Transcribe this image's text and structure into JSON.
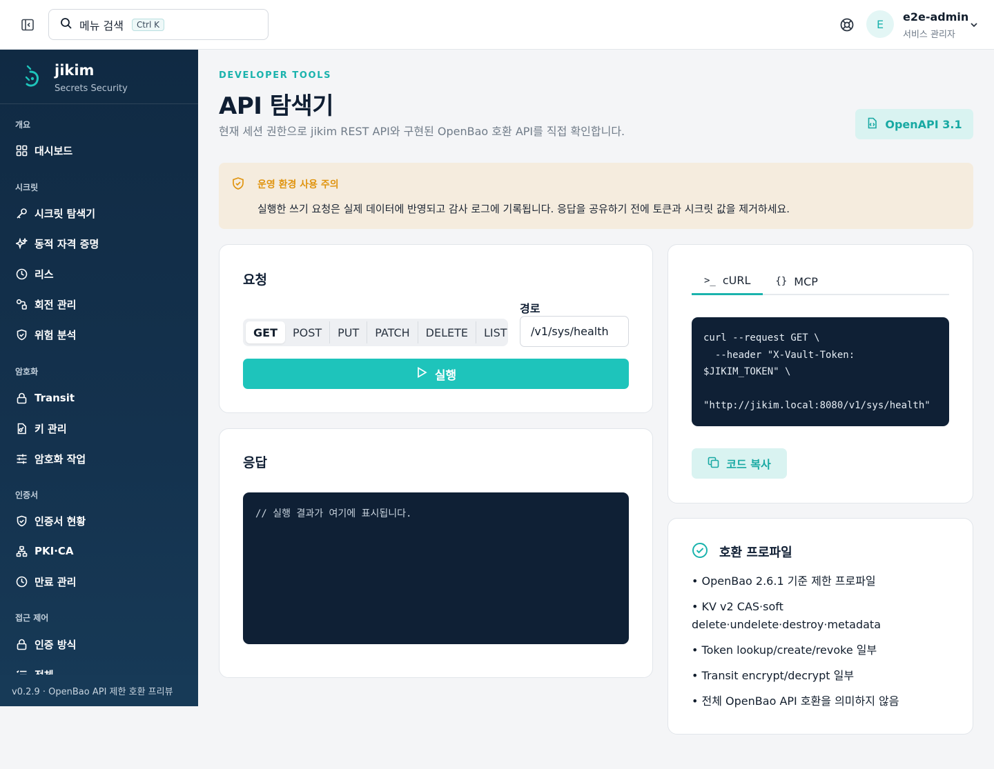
{
  "topbar": {
    "search_label": "메뉴 검색",
    "search_shortcut": "Ctrl K",
    "user": {
      "initial": "E",
      "name": "e2e-admin",
      "role": "서비스 관리자"
    }
  },
  "sidebar": {
    "brand": {
      "name": "jikim",
      "subtitle": "Secrets Security"
    },
    "sections": [
      {
        "title": "개요",
        "items": [
          {
            "label": "대시보드",
            "icon": "dashboard-icon"
          }
        ]
      },
      {
        "title": "시크릿",
        "items": [
          {
            "label": "시크릿 탐색기",
            "icon": "key-icon"
          },
          {
            "label": "동적 자격 증명",
            "icon": "sparkle-icon"
          },
          {
            "label": "리스",
            "icon": "clock-icon"
          },
          {
            "label": "회전 관리",
            "icon": "rotate-icon"
          },
          {
            "label": "위험 분석",
            "icon": "shield-icon"
          }
        ]
      },
      {
        "title": "암호화",
        "items": [
          {
            "label": "Transit",
            "icon": "lock-icon"
          },
          {
            "label": "키 관리",
            "icon": "key-file-icon"
          },
          {
            "label": "암호화 작업",
            "icon": "sliders-icon"
          }
        ]
      },
      {
        "title": "인증서",
        "items": [
          {
            "label": "인증서 현황",
            "icon": "shield-icon"
          },
          {
            "label": "PKI·CA",
            "icon": "network-icon"
          },
          {
            "label": "만료 관리",
            "icon": "clock-icon"
          }
        ]
      },
      {
        "title": "접근 제어",
        "items": [
          {
            "label": "인증 방식",
            "icon": "lock-icon"
          },
          {
            "label": "전체",
            "icon": "list-icon"
          }
        ]
      }
    ],
    "footer": "v0.2.9 · OpenBao API 제한 호환 프리뷰"
  },
  "header": {
    "eyebrow": "DEVELOPER TOOLS",
    "title": "API 탐색기",
    "description": "현재 세션 권한으로 jikim REST API와 구현된 OpenBao 호환 API를 직접 확인합니다.",
    "openapi_label": "OpenAPI 3.1"
  },
  "warning": {
    "title": "운영 환경 사용 주의",
    "body": "실행한 쓰기 요청은 실제 데이터에 반영되고 감사 로그에 기록됩니다. 응답을 공유하기 전에 토큰과 시크릿 값을 제거하세요."
  },
  "request": {
    "title": "요청",
    "methods": [
      "GET",
      "POST",
      "PUT",
      "PATCH",
      "DELETE",
      "LIST"
    ],
    "selected_method": "GET",
    "path_label": "경로",
    "path_value": "/v1/sys/health",
    "run_label": "실행"
  },
  "response": {
    "title": "응답",
    "placeholder": "// 실행 결과가 여기에 표시됩니다."
  },
  "code_panel": {
    "tabs": [
      "cURL",
      "MCP"
    ],
    "active_tab": "cURL",
    "code": "curl --request GET \\\n  --header \"X-Vault-Token:\n$JIKIM_TOKEN\" \\\n\n\"http://jikim.local:8080/v1/sys/health\"",
    "copy_label": "코드 복사"
  },
  "profile": {
    "title": "호환 프로파일",
    "items": [
      "• OpenBao 2.6.1 기준 제한 프로파일",
      "• KV v2 CAS·soft delete·undelete·destroy·metadata",
      "• Token lookup/create/revoke 일부",
      "• Transit encrypt/decrypt 일부",
      "• 전체 OpenBao API 호환을 의미하지 않음"
    ]
  },
  "colors": {
    "accent": "#1ec4bb",
    "accent_text": "#18a9a3",
    "sidebar_bg": "#102a43",
    "warning_bg": "#f5ecde",
    "warning_text": "#e0940f",
    "code_bg": "#0f2035"
  }
}
